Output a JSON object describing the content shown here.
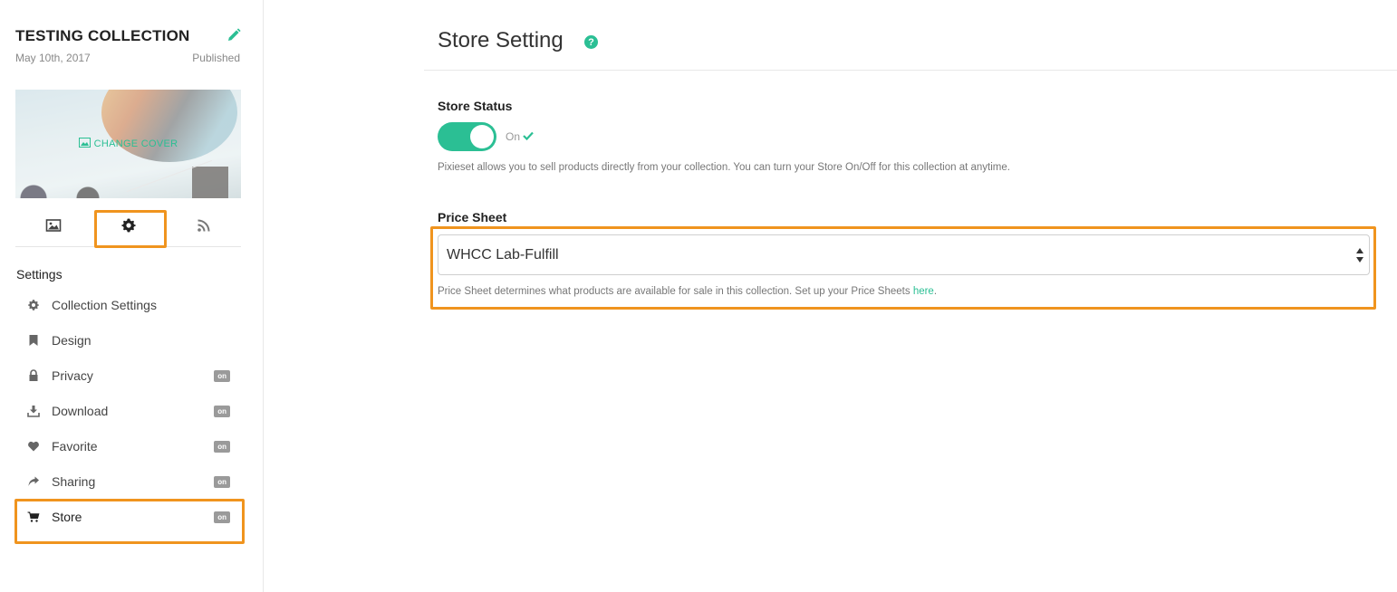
{
  "collection": {
    "title": "TESTING COLLECTION",
    "date": "May 10th, 2017",
    "status": "Published",
    "change_cover_label": "CHANGE COVER"
  },
  "tabs": [
    {
      "icon": "image-icon"
    },
    {
      "icon": "gear-icon",
      "active": true
    },
    {
      "icon": "rss-icon"
    }
  ],
  "sidebar": {
    "heading": "Settings",
    "items": [
      {
        "label": "Collection Settings",
        "icon": "gear-icon",
        "badge": ""
      },
      {
        "label": "Design",
        "icon": "bookmark-icon",
        "badge": ""
      },
      {
        "label": "Privacy",
        "icon": "lock-icon",
        "badge": "on"
      },
      {
        "label": "Download",
        "icon": "download-icon",
        "badge": "on"
      },
      {
        "label": "Favorite",
        "icon": "heart-icon",
        "badge": "on"
      },
      {
        "label": "Sharing",
        "icon": "share-icon",
        "badge": "on"
      },
      {
        "label": "Store",
        "icon": "cart-icon",
        "badge": "on"
      }
    ]
  },
  "main": {
    "title": "Store Setting",
    "help_symbol": "?",
    "store_status": {
      "label": "Store Status",
      "state": "On",
      "enabled": true,
      "help": "Pixieset allows you to sell products directly from your collection. You can turn your Store On/Off for this collection at anytime."
    },
    "price_sheet": {
      "label": "Price Sheet",
      "selected": "WHCC Lab-Fulfill",
      "help_prefix": "Price Sheet determines what products are available for sale in this collection. Set up your Price Sheets ",
      "help_link": "here",
      "help_suffix": "."
    }
  },
  "colors": {
    "accent": "#2bbf94",
    "highlight": "#f0941e",
    "badge": "#9a9a9a"
  }
}
